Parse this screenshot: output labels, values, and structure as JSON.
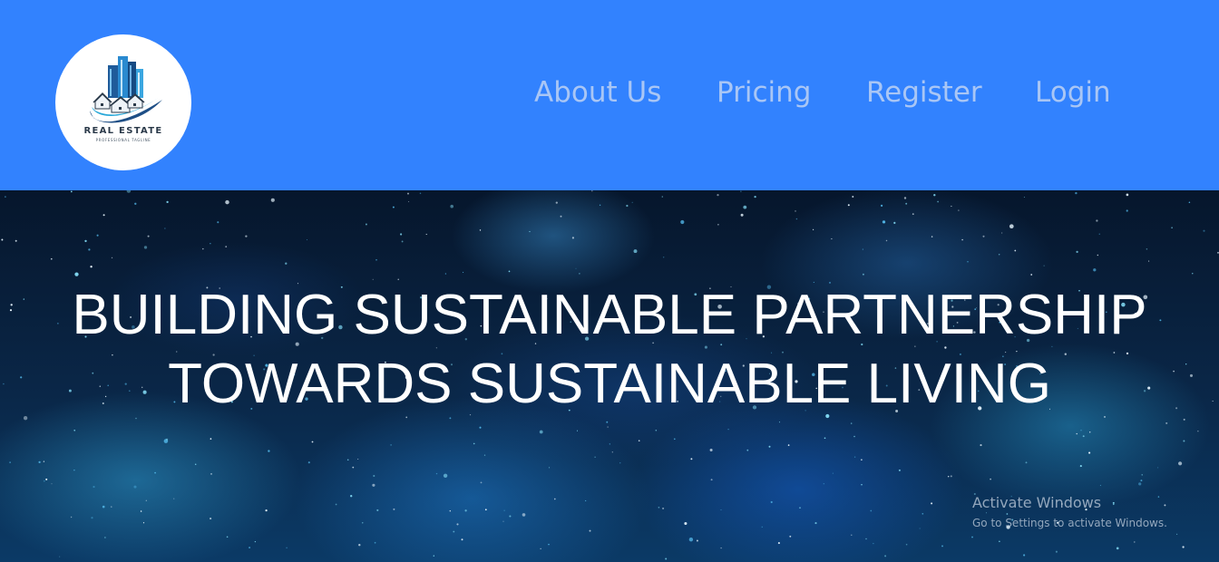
{
  "header": {
    "background": "#3282fe",
    "nav_color": "#a9c6f5",
    "logo": {
      "title": "REAL ESTATE",
      "tagline": "PROFESSIONAL TAGLINE",
      "icon": "city-buildings-logo"
    },
    "nav": [
      {
        "label": "About Us"
      },
      {
        "label": "Pricing"
      },
      {
        "label": "Register"
      },
      {
        "label": "Login"
      }
    ]
  },
  "hero": {
    "line1": "BUILDING SUSTAINABLE PARTNERSHIP",
    "line2": "TOWARDS SUSTAINABLE LIVING",
    "text_color": "#ffffff",
    "background": "starry-galaxy"
  },
  "watermark": {
    "title": "Activate Windows",
    "subtitle": "Go to Settings to activate Windows."
  }
}
